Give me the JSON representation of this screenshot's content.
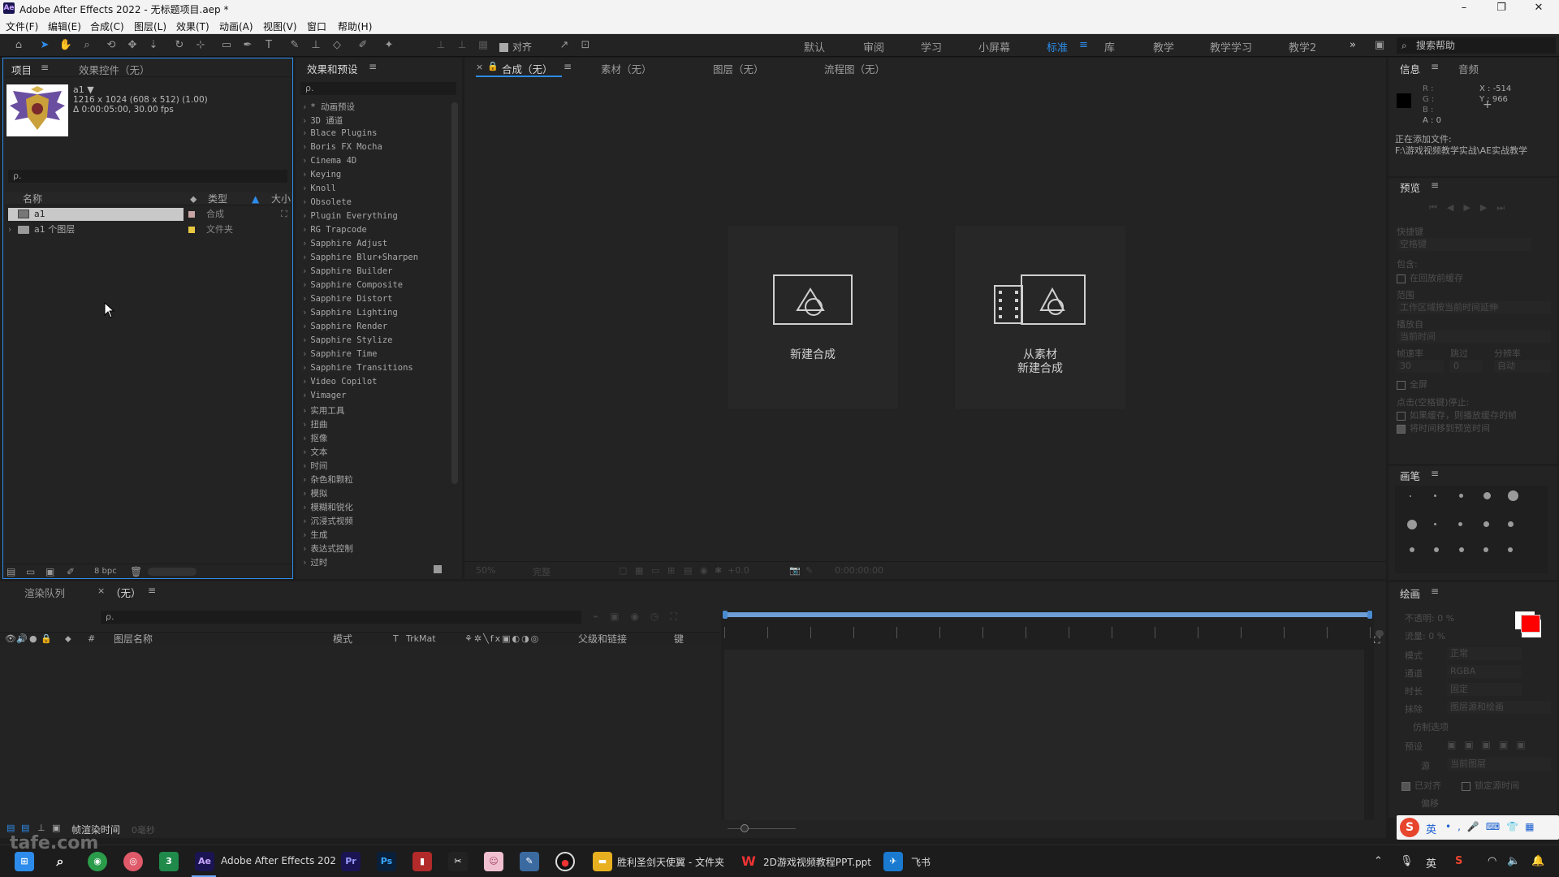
{
  "app": {
    "title": "Adobe After Effects 2022 - 无标题项目.aep *",
    "logo": "Ae"
  },
  "window_controls": {
    "minimize": "–",
    "maximize": "❐",
    "close": "✕"
  },
  "menu": [
    "文件(F)",
    "编辑(E)",
    "合成(C)",
    "图层(L)",
    "效果(T)",
    "动画(A)",
    "视图(V)",
    "窗口",
    "帮助(H)"
  ],
  "toolbar": {
    "align_label": "对齐",
    "workspaces": [
      "默认",
      "审阅",
      "学习",
      "小屏幕",
      "标准",
      "库",
      "教学",
      "教学学习",
      "教学2"
    ],
    "active_workspace": "标准",
    "more": "»",
    "search_help": "搜索帮助"
  },
  "project_panel": {
    "tab_project": "项目",
    "tab_effect_controls": "效果控件（无）",
    "selected_name": "a1 ▼",
    "selected_info1": "1216 x 1024  (608 x 512) (1.00)",
    "selected_info2": "Δ 0:00:05:00, 30.00 fps",
    "search_placeholder": "ρ.",
    "col_name": "名称",
    "col_type": "类型",
    "col_size": "大小",
    "items": [
      {
        "name": "a1",
        "type": "合成",
        "color": "#c8a4a4"
      },
      {
        "name": "a1 个图层",
        "type": "文件夹",
        "color": "#e8c840"
      }
    ],
    "bpc": "8 bpc"
  },
  "effects_panel": {
    "title": "效果和预设",
    "search_placeholder": "ρ.",
    "items": [
      "* 动画预设",
      "3D 通道",
      "Blace Plugins",
      "Boris FX Mocha",
      "Cinema 4D",
      "Keying",
      "Knoll",
      "Obsolete",
      "Plugin Everything",
      "RG Trapcode",
      "Sapphire Adjust",
      "Sapphire Blur+Sharpen",
      "Sapphire Builder",
      "Sapphire Composite",
      "Sapphire Distort",
      "Sapphire Lighting",
      "Sapphire Render",
      "Sapphire Stylize",
      "Sapphire Time",
      "Sapphire Transitions",
      "Video Copilot",
      "Vimager",
      "实用工具",
      "扭曲",
      "抠像",
      "文本",
      "时间",
      "杂色和颗粒",
      "模拟",
      "模糊和锐化",
      "沉浸式视频",
      "生成",
      "表达式控制",
      "过时"
    ]
  },
  "viewer": {
    "tab_comp": "合成（无）",
    "tab_footage": "素材（无）",
    "tab_layer": "图层（无）",
    "tab_flowchart": "流程图（无）",
    "new_comp": "新建合成",
    "from_footage_line1": "从素材",
    "from_footage_line2": "新建合成",
    "zoom": "50%",
    "quality": "完整",
    "exposure": "+0.0",
    "timecode": "0:00:00:00"
  },
  "info_panel": {
    "tab_info": "信息",
    "tab_audio": "音频",
    "r": "R :",
    "g": "G :",
    "b": "B :",
    "a": "A : 0",
    "x": "X : -514",
    "y": "Y : 966",
    "status1": "正在添加文件:",
    "status2": "F:\\游戏视频教学实战\\AE实战教学"
  },
  "preview_panel": {
    "title": "预览",
    "shortcut_label": "快捷键",
    "shortcut_value": "空格键",
    "include": "包含:",
    "cache": "在回放前缓存",
    "range": "范围",
    "range_value": "工作区域按当前时间延伸",
    "play_from": "播放自",
    "play_from_value": "当前时间",
    "frame_rate": "帧速率",
    "skip": "跳过",
    "resolution": "分辨率",
    "fps_value": "30",
    "skip_value": "0",
    "res_value": "自动",
    "fullscreen": "全屏",
    "stop_label": "点击(空格键)停止:",
    "opt1": "如果缓存，则播放缓存的帧",
    "opt2": "将时间移到预览时间"
  },
  "brush_panel": {
    "title": "画笔"
  },
  "paint_panel": {
    "title": "绘画",
    "opacity": "不透明: 0 %",
    "flow": "流量: 0 %",
    "mode_label": "模式",
    "mode_value": "正常",
    "channel_label": "通道",
    "channel_value": "RGBA",
    "duration_label": "时长",
    "duration_value": "固定",
    "erase_label": "抹除",
    "erase_value": "图层源和绘画",
    "clone_options": "仿制选项",
    "preset_label": "预设",
    "source_label": "源",
    "source_value": "当前图层",
    "aligned": "已对齐",
    "lock_time": "锁定源时间",
    "offset": "偏移",
    "fg_color": "#ff0000",
    "bg_color": "#ffffff"
  },
  "timeline": {
    "tab_render": "渲染队列",
    "tab_comp": "（无）",
    "col_layer_name": "图层名称",
    "col_mode": "模式",
    "col_t": "T",
    "col_trkmat": "TrkMat",
    "col_parent": "父级和链接",
    "col_keys": "键",
    "frame_render": "帧渲染时间",
    "frame_render_value": "0毫秒"
  },
  "taskbar": {
    "ae_label": "Adobe After Effects 202",
    "folder_label": "胜利圣剑天使翼 - 文件夹",
    "ppt_label": "2D游戏视频教程PPT.ppt",
    "feishu_label": "飞书",
    "ime": "英",
    "tray_ime": "英"
  },
  "watermark": "tafe.com"
}
